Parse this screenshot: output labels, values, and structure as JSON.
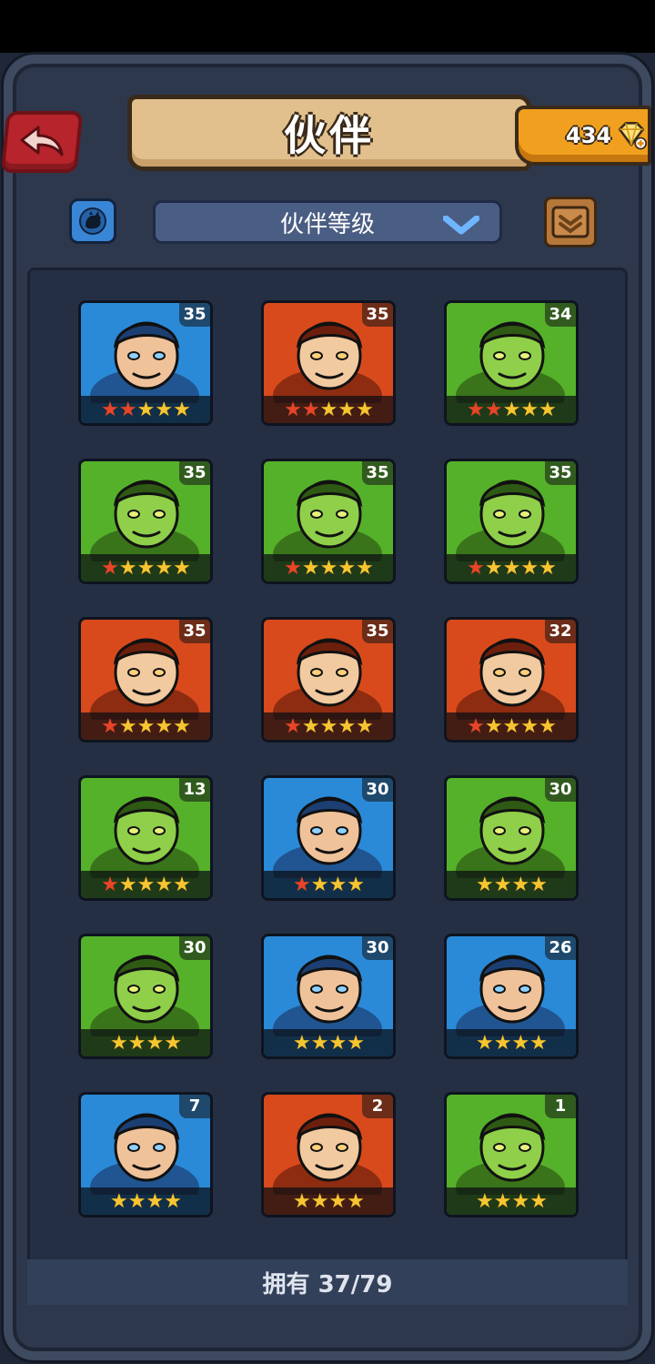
{
  "header": {
    "title": "伙伴",
    "gems": "434"
  },
  "toolbar": {
    "sort_label": "伙伴等级"
  },
  "colors": {
    "frame": "#2d384d",
    "banner": "#e2c08e",
    "gem_badge": "#f0a01e",
    "back_button": "#b7242b"
  },
  "partners": [
    {
      "level": "35",
      "bg": "blue",
      "red_stars": 2,
      "stars": 5,
      "icon": "hooded-mage"
    },
    {
      "level": "35",
      "bg": "red",
      "red_stars": 2,
      "stars": 5,
      "icon": "panda"
    },
    {
      "level": "34",
      "bg": "green",
      "red_stars": 2,
      "stars": 5,
      "icon": "crocodile"
    },
    {
      "level": "35",
      "bg": "green",
      "red_stars": 1,
      "stars": 5,
      "icon": "scarecrow"
    },
    {
      "level": "35",
      "bg": "green",
      "red_stars": 1,
      "stars": 5,
      "icon": "warrior-woman"
    },
    {
      "level": "35",
      "bg": "green",
      "red_stars": 1,
      "stars": 5,
      "icon": "armored-beast"
    },
    {
      "level": "35",
      "bg": "red",
      "red_stars": 1,
      "stars": 5,
      "icon": "bearded-hero"
    },
    {
      "level": "35",
      "bg": "red",
      "red_stars": 1,
      "stars": 5,
      "icon": "afro-fighter"
    },
    {
      "level": "32",
      "bg": "red",
      "red_stars": 1,
      "stars": 5,
      "icon": "skull-totem"
    },
    {
      "level": "13",
      "bg": "green",
      "red_stars": 1,
      "stars": 5,
      "icon": "ranger"
    },
    {
      "level": "30",
      "bg": "blue",
      "red_stars": 1,
      "stars": 4,
      "icon": "barbarian"
    },
    {
      "level": "30",
      "bg": "green",
      "red_stars": 0,
      "stars": 4,
      "icon": "frog-monster"
    },
    {
      "level": "30",
      "bg": "green",
      "red_stars": 0,
      "stars": 4,
      "icon": "green-boar"
    },
    {
      "level": "30",
      "bg": "blue",
      "red_stars": 0,
      "stars": 4,
      "icon": "blue-boar"
    },
    {
      "level": "26",
      "bg": "blue",
      "red_stars": 0,
      "stars": 4,
      "icon": "blue-lizard"
    },
    {
      "level": "7",
      "bg": "blue",
      "red_stars": 0,
      "stars": 4,
      "icon": "boar-pup"
    },
    {
      "level": "2",
      "bg": "red",
      "red_stars": 0,
      "stars": 4,
      "icon": "salamander"
    },
    {
      "level": "1",
      "bg": "green",
      "red_stars": 0,
      "stars": 4,
      "icon": "scarecrow-small"
    }
  ],
  "footer": {
    "owned_label": "拥有 37/79"
  }
}
